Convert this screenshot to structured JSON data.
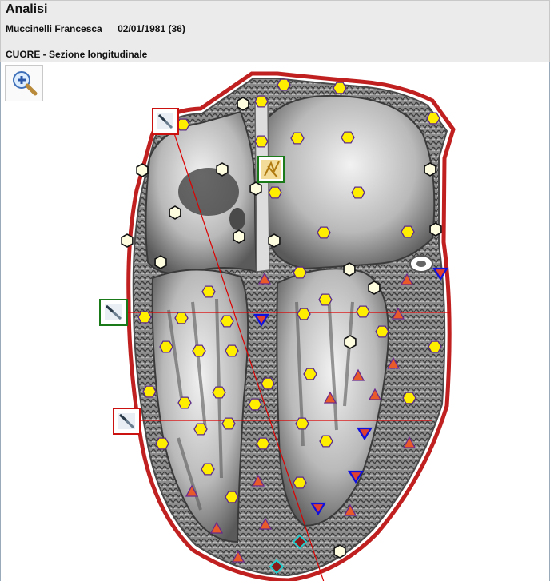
{
  "header": {
    "title": "Analisi",
    "patient_name": "Muccinelli  Francesca",
    "patient_dob": "02/01/1981 (36)",
    "section": "CUORE - Sezione longitudinale"
  },
  "icons": {
    "zoom": "zoom-in-magnifier-icon",
    "probe": "scalpel-probe-icon",
    "tissue": "tissue-sample-icon"
  },
  "colors": {
    "marker_yellow": "#ffee00",
    "marker_white": "#fffde0",
    "marker_triangle": "#e85a2a",
    "marker_down": "#1111dd",
    "marker_diamond": "#8a1a1a",
    "cut_line": "#dd0000",
    "probe_active": "#cc1111",
    "probe_selected": "#1a7a1a"
  }
}
